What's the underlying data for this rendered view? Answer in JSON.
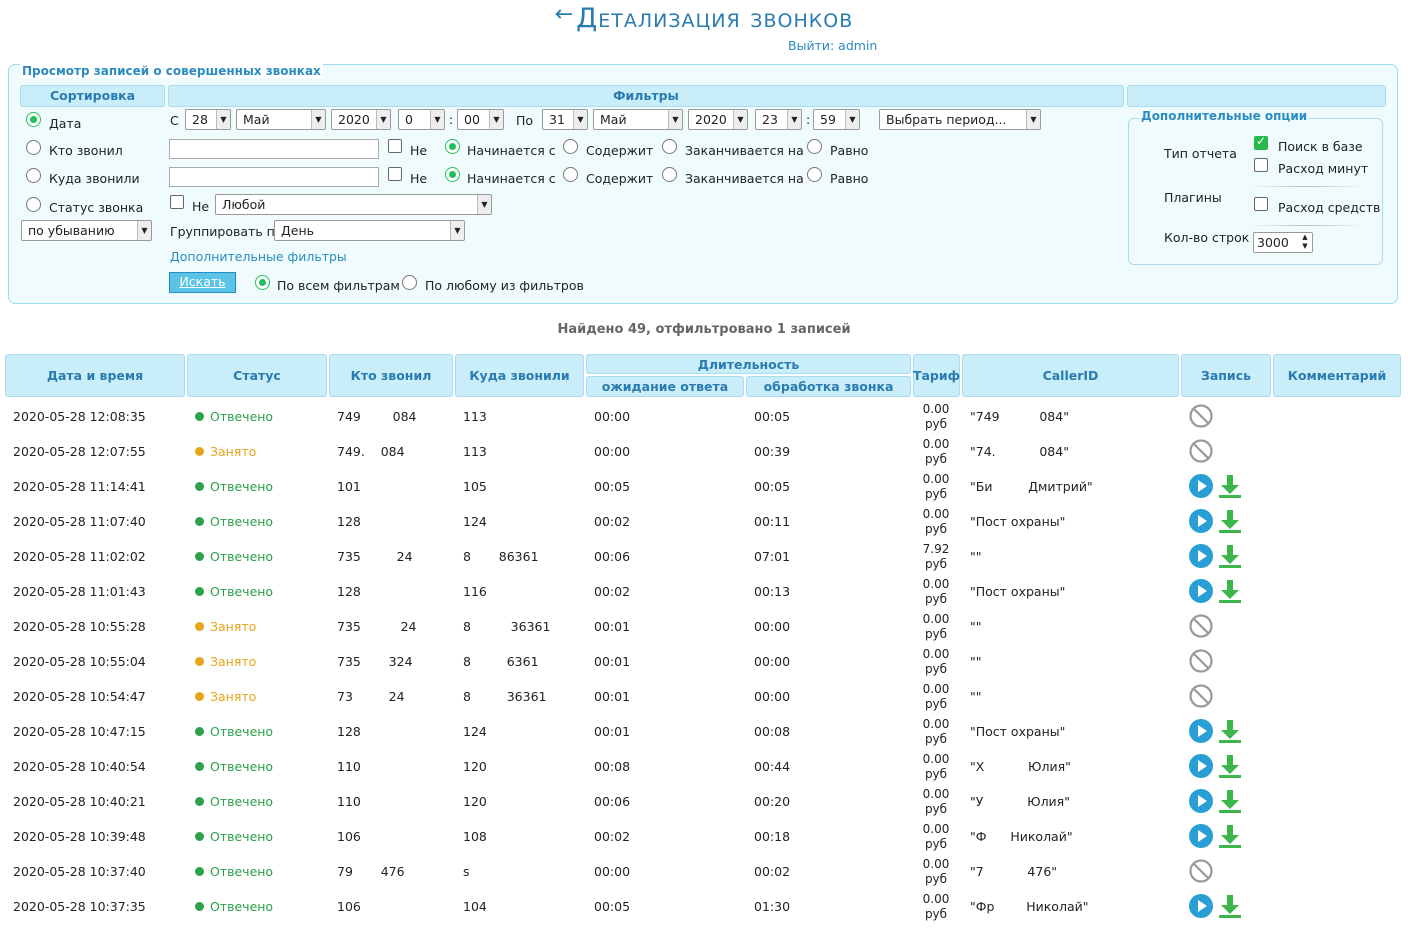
{
  "header": {
    "back_arrow": "←",
    "title": "Детализация звонков",
    "logout": "Выйти: admin"
  },
  "panel": {
    "legend": "Просмотр записей о совершенных звонках",
    "sort_header": "Сортировка",
    "filters_header": "Фильтры",
    "sort": {
      "options": [
        "Дата",
        "Кто звонил",
        "Куда звонили",
        "Статус звонка"
      ],
      "selected": "Дата",
      "order": "по убыванию"
    },
    "date_from_label": "С",
    "date_from": {
      "day": "28",
      "month": "Май",
      "year": "2020",
      "hour": "0",
      "minute": "00"
    },
    "date_to_label": "По",
    "date_to": {
      "day": "31",
      "month": "Май",
      "year": "2020",
      "hour": "23",
      "minute": "59"
    },
    "time_sep": ":",
    "period_select": "Выбрать период...",
    "not_label": "Не",
    "match_options": [
      "Начинается с",
      "Содержит",
      "Заканчивается на",
      "Равно"
    ],
    "status_select": "Любой",
    "group_label": "Группировать по",
    "group_value": "День",
    "extra_filters_link": "Дополнительные фильтры",
    "search_button": "Искать",
    "mode_all": "По всем фильтрам",
    "mode_any": "По любому из фильтров"
  },
  "options": {
    "legend": "Дополнительные опции",
    "report_type_label": "Тип отчета",
    "report_db": "Поиск в базе",
    "report_minutes": "Расход минут",
    "plugins_label": "Плагины",
    "plugin_money": "Расход средств",
    "rows_label": "Кол-во строк",
    "rows_value": "3000"
  },
  "summary": "Найдено 49, отфильтровано 1 записей",
  "table": {
    "headers": {
      "datetime": "Дата и время",
      "status": "Статус",
      "caller": "Кто звонил",
      "callee": "Куда звонили",
      "duration": "Длительность",
      "wait": "ожидание ответа",
      "talk": "обработка звонка",
      "tariff": "Тариф",
      "callerid": "CallerID",
      "record": "Запись",
      "comment": "Комментарий"
    },
    "rows": [
      {
        "datetime": "2020-05-28 12:08:35",
        "status": "Отвечено",
        "kind": "ok",
        "caller": "749        084",
        "callee": "113",
        "wait": "00:00",
        "talk": "00:05",
        "tariff_value": "0.00",
        "tariff_unit": "руб",
        "callerid": "\"749          084\"",
        "has_record": false
      },
      {
        "datetime": "2020-05-28 12:07:55",
        "status": "Занято",
        "kind": "busy",
        "caller": "749.    084",
        "callee": "113",
        "wait": "00:00",
        "talk": "00:39",
        "tariff_value": "0.00",
        "tariff_unit": "руб",
        "callerid": "\"74.           084\"",
        "has_record": false
      },
      {
        "datetime": "2020-05-28 11:14:41",
        "status": "Отвечено",
        "kind": "ok",
        "caller": "101",
        "callee": "105",
        "wait": "00:05",
        "talk": "00:05",
        "tariff_value": "0.00",
        "tariff_unit": "руб",
        "callerid": "\"Би         Дмитрий\"",
        "has_record": true
      },
      {
        "datetime": "2020-05-28 11:07:40",
        "status": "Отвечено",
        "kind": "ok",
        "caller": "128",
        "callee": "124",
        "wait": "00:02",
        "talk": "00:11",
        "tariff_value": "0.00",
        "tariff_unit": "руб",
        "callerid": "\"Пост охраны\"",
        "has_record": true
      },
      {
        "datetime": "2020-05-28 11:02:02",
        "status": "Отвечено",
        "kind": "ok",
        "caller": "735         24",
        "callee": "8       86361",
        "wait": "00:06",
        "talk": "07:01",
        "tariff_value": "7.92",
        "tariff_unit": "руб",
        "callerid": "\"\"",
        "has_record": true
      },
      {
        "datetime": "2020-05-28 11:01:43",
        "status": "Отвечено",
        "kind": "ok",
        "caller": "128",
        "callee": "116",
        "wait": "00:02",
        "talk": "00:13",
        "tariff_value": "0.00",
        "tariff_unit": "руб",
        "callerid": "\"Пост охраны\"",
        "has_record": true
      },
      {
        "datetime": "2020-05-28 10:55:28",
        "status": "Занято",
        "kind": "busy",
        "caller": "735          24",
        "callee": "8          36361",
        "wait": "00:01",
        "talk": "00:00",
        "tariff_value": "0.00",
        "tariff_unit": "руб",
        "callerid": "\"\"",
        "has_record": false
      },
      {
        "datetime": "2020-05-28 10:55:04",
        "status": "Занято",
        "kind": "busy",
        "caller": "735       324",
        "callee": "8         6361",
        "wait": "00:01",
        "talk": "00:00",
        "tariff_value": "0.00",
        "tariff_unit": "руб",
        "callerid": "\"\"",
        "has_record": false
      },
      {
        "datetime": "2020-05-28 10:54:47",
        "status": "Занято",
        "kind": "busy",
        "caller": "73         24",
        "callee": "8         36361",
        "wait": "00:01",
        "talk": "00:00",
        "tariff_value": "0.00",
        "tariff_unit": "руб",
        "callerid": "\"\"",
        "has_record": false
      },
      {
        "datetime": "2020-05-28 10:47:15",
        "status": "Отвечено",
        "kind": "ok",
        "caller": "128",
        "callee": "124",
        "wait": "00:01",
        "talk": "00:08",
        "tariff_value": "0.00",
        "tariff_unit": "руб",
        "callerid": "\"Пост охраны\"",
        "has_record": true
      },
      {
        "datetime": "2020-05-28 10:40:54",
        "status": "Отвечено",
        "kind": "ok",
        "caller": "110",
        "callee": "120",
        "wait": "00:08",
        "talk": "00:44",
        "tariff_value": "0.00",
        "tariff_unit": "руб",
        "callerid": "\"Х           Юлия\"",
        "has_record": true
      },
      {
        "datetime": "2020-05-28 10:40:21",
        "status": "Отвечено",
        "kind": "ok",
        "caller": "110",
        "callee": "120",
        "wait": "00:06",
        "talk": "00:20",
        "tariff_value": "0.00",
        "tariff_unit": "руб",
        "callerid": "\"У           Юлия\"",
        "has_record": true
      },
      {
        "datetime": "2020-05-28 10:39:48",
        "status": "Отвечено",
        "kind": "ok",
        "caller": "106",
        "callee": "108",
        "wait": "00:02",
        "talk": "00:18",
        "tariff_value": "0.00",
        "tariff_unit": "руб",
        "callerid": "\"Ф      Николай\"",
        "has_record": true
      },
      {
        "datetime": "2020-05-28 10:37:40",
        "status": "Отвечено",
        "kind": "ok",
        "caller": "79       476",
        "callee": "s",
        "wait": "00:00",
        "talk": "00:02",
        "tariff_value": "0.00",
        "tariff_unit": "руб",
        "callerid": "\"7           476\"",
        "has_record": false
      },
      {
        "datetime": "2020-05-28 10:37:35",
        "status": "Отвечено",
        "kind": "ok",
        "caller": "106",
        "callee": "104",
        "wait": "00:05",
        "talk": "01:30",
        "tariff_value": "0.00",
        "tariff_unit": "руб",
        "callerid": "\"Фр        Николай\"",
        "has_record": true
      }
    ]
  },
  "colors": {
    "accent": "#2a7bb0",
    "header_bg": "#c9eefa",
    "answered": "#2aa14a",
    "busy": "#e8a317",
    "play": "#2a9fd6",
    "download": "#3cb54a"
  }
}
